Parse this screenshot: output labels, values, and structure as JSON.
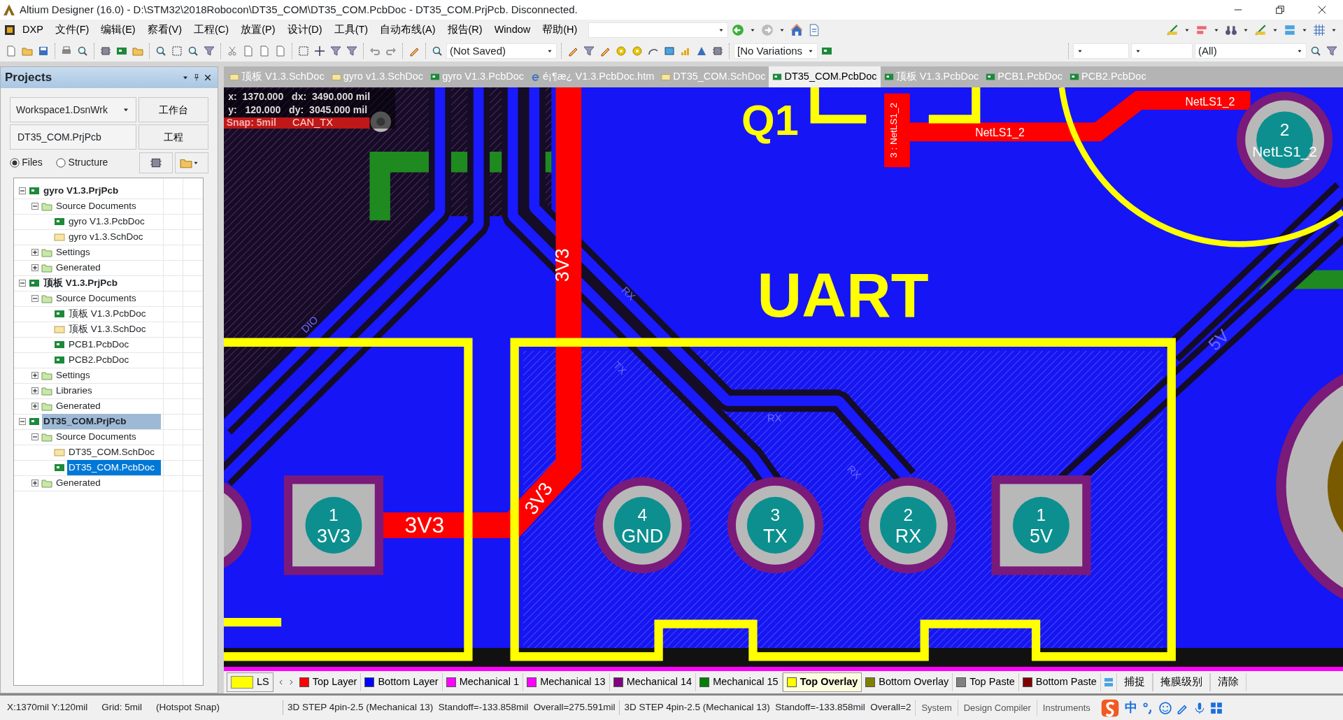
{
  "window": {
    "title": "Altium Designer (16.0) - D:\\STM32\\2018Robocon\\DT35_COM\\DT35_COM.PcbDoc - DT35_COM.PrjPcb. Disconnected."
  },
  "menu": [
    "DXP",
    "文件(F)",
    "编辑(E)",
    "察看(V)",
    "工程(C)",
    "放置(P)",
    "设计(D)",
    "工具(T)",
    "自动布线(A)",
    "报告(R)",
    "Window",
    "帮助(H)"
  ],
  "toolbar": {
    "variant_dropdown": "(Not Saved)",
    "variations_dropdown": "[No Variations",
    "filter_dropdown": "(All)"
  },
  "projects_panel": {
    "title": "Projects",
    "workspace": "Workspace1.DsnWrk",
    "workspace_button": "工作台",
    "project": "DT35_COM.PrjPcb",
    "project_button": "工程",
    "view_options": [
      {
        "label": "Files",
        "selected": true
      },
      {
        "label": "Structure",
        "selected": false
      }
    ],
    "tree": [
      {
        "label": "gyro V1.3.PrjPcb",
        "kind": "project",
        "expanded": true,
        "active": false,
        "selected": false,
        "children": [
          {
            "label": "Source Documents",
            "kind": "folder",
            "expanded": true,
            "selected": false,
            "children": [
              {
                "label": "gyro V1.3.PcbDoc",
                "kind": "pcb",
                "selected": false
              },
              {
                "label": "gyro v1.3.SchDoc",
                "kind": "sch",
                "selected": false
              }
            ]
          },
          {
            "label": "Settings",
            "kind": "folder",
            "expanded": false,
            "selected": false
          },
          {
            "label": "Generated",
            "kind": "folder",
            "expanded": false,
            "selected": false
          }
        ]
      },
      {
        "label": "顶板 V1.3.PrjPcb",
        "kind": "project",
        "expanded": true,
        "active": false,
        "selected": false,
        "children": [
          {
            "label": "Source Documents",
            "kind": "folder",
            "expanded": true,
            "selected": false,
            "children": [
              {
                "label": "顶板 V1.3.PcbDoc",
                "kind": "pcb",
                "selected": false
              },
              {
                "label": "顶板 V1.3.SchDoc",
                "kind": "sch",
                "selected": false
              },
              {
                "label": "PCB1.PcbDoc",
                "kind": "pcb",
                "selected": false
              },
              {
                "label": "PCB2.PcbDoc",
                "kind": "pcb",
                "selected": false
              }
            ]
          },
          {
            "label": "Settings",
            "kind": "folder",
            "expanded": false,
            "selected": false
          },
          {
            "label": "Libraries",
            "kind": "folder",
            "expanded": false,
            "selected": false
          },
          {
            "label": "Generated",
            "kind": "folder",
            "expanded": false,
            "selected": false
          }
        ]
      },
      {
        "label": "DT35_COM.PrjPcb",
        "kind": "project",
        "expanded": true,
        "active": true,
        "selected": false,
        "children": [
          {
            "label": "Source Documents",
            "kind": "folder",
            "expanded": true,
            "selected": false,
            "children": [
              {
                "label": "DT35_COM.SchDoc",
                "kind": "sch",
                "selected": false
              },
              {
                "label": "DT35_COM.PcbDoc",
                "kind": "pcb",
                "selected": true
              }
            ]
          },
          {
            "label": "Generated",
            "kind": "folder",
            "expanded": false,
            "selected": false
          }
        ]
      }
    ]
  },
  "document_tabs": [
    {
      "label": "顶板 V1.3.SchDoc",
      "kind": "sch",
      "selected": false
    },
    {
      "label": "gyro v1.3.SchDoc",
      "kind": "sch",
      "selected": false
    },
    {
      "label": "gyro V1.3.PcbDoc",
      "kind": "pcb",
      "selected": false
    },
    {
      "label": "é¡¶æ¿ V1.3.PcbDoc.htm",
      "kind": "htm",
      "selected": false
    },
    {
      "label": "DT35_COM.SchDoc",
      "kind": "sch",
      "selected": false
    },
    {
      "label": "DT35_COM.PcbDoc",
      "kind": "pcb",
      "selected": true
    },
    {
      "label": "顶板 V1.3.PcbDoc",
      "kind": "pcb",
      "selected": false
    },
    {
      "label": "PCB1.PcbDoc",
      "kind": "pcb",
      "selected": false
    },
    {
      "label": "PCB2.PcbDoc",
      "kind": "pcb",
      "selected": false
    }
  ],
  "canvas": {
    "hud": [
      "x:  1370.000   dx:  3490.000 mil",
      "y:   120.000   dy:  3045.000 mil",
      "Snap: 5mil"
    ],
    "silkscreen": [
      "Q1",
      "UART"
    ],
    "net_labels": [
      "3V3",
      "3V3",
      "3V3",
      "NetLS1_2",
      "NetLS1_2",
      "3 : NetLS1_2"
    ],
    "trace_labels": [
      "CAN_TX",
      "DIO",
      "RX",
      "TX",
      "RX",
      "RX",
      "5V"
    ],
    "pads": [
      {
        "number": "1",
        "net": "3V3",
        "kind": "square"
      },
      {
        "number": "4",
        "net": "GND",
        "kind": "round"
      },
      {
        "number": "3",
        "net": "TX",
        "kind": "round"
      },
      {
        "number": "2",
        "net": "RX",
        "kind": "round"
      },
      {
        "number": "1",
        "net": "5V",
        "kind": "square"
      },
      {
        "number": "2",
        "net": "NetLS1_2",
        "kind": "round"
      }
    ]
  },
  "layer_tabs": {
    "current_layer": {
      "label": "LS",
      "color": "#ffff00"
    },
    "layers": [
      {
        "label": "Top Layer",
        "color": "#ff0000",
        "selected": false
      },
      {
        "label": "Bottom Layer",
        "color": "#0000ff",
        "selected": false
      },
      {
        "label": "Mechanical 1",
        "color": "#ff00ff",
        "selected": false
      },
      {
        "label": "Mechanical 13",
        "color": "#ff00ff",
        "selected": false
      },
      {
        "label": "Mechanical 14",
        "color": "#800080",
        "selected": false
      },
      {
        "label": "Mechanical 15",
        "color": "#008000",
        "selected": false
      },
      {
        "label": "Top Overlay",
        "color": "#ffff00",
        "selected": true
      },
      {
        "label": "Bottom Overlay",
        "color": "#808000",
        "selected": false
      },
      {
        "label": "Top Paste",
        "color": "#808080",
        "selected": false
      },
      {
        "label": "Bottom Paste",
        "color": "#800000",
        "selected": false
      }
    ],
    "buttons": [
      "捕捉",
      "掩膜级别",
      "清除"
    ]
  },
  "status_bar": {
    "coords": "X:1370mil Y:120mil",
    "grid": "Grid: 5mil",
    "snap": "(Hotspot Snap)",
    "messages": [
      "3D STEP 4pin-2.5 (Mechanical 13)  Standoff=-133.858mil  Overall=275.591mil",
      "3D STEP 4pin-2.5 (Mechanical 13)  Standoff=-133.858mil  Overall=2"
    ],
    "panels": [
      "System",
      "Design Compiler",
      "Instruments"
    ],
    "ime_mode": "中"
  }
}
